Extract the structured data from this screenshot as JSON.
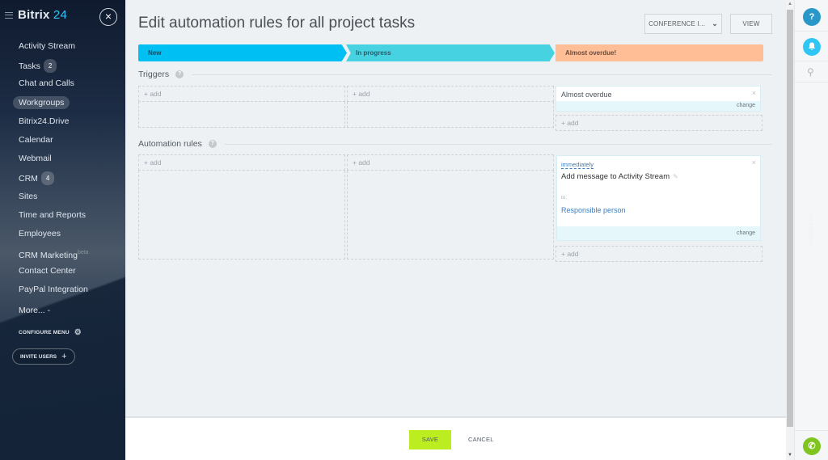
{
  "app": {
    "logo_name": "Bitrix",
    "logo_num": "24",
    "close_label": "×"
  },
  "sidebar": {
    "items": [
      {
        "label": "Activity Stream"
      },
      {
        "label": "Tasks",
        "badge": "2"
      },
      {
        "label": "Chat and Calls"
      },
      {
        "label": "Workgroups",
        "active": true
      },
      {
        "label": "Bitrix24.Drive"
      },
      {
        "label": "Calendar"
      },
      {
        "label": "Webmail"
      },
      {
        "label": "CRM",
        "badge": "4"
      },
      {
        "label": "Sites"
      },
      {
        "label": "Time and Reports"
      },
      {
        "label": "Employees"
      },
      {
        "label": "CRM Marketing",
        "suffix": "beta"
      },
      {
        "label": "Contact Center"
      },
      {
        "label": "PayPal Integration"
      },
      {
        "label": "More... -"
      }
    ],
    "configure_label": "CONFIGURE MENU",
    "invite_label": "INVITE USERS"
  },
  "header": {
    "title": "Edit automation rules for all project tasks",
    "conference_label": "CONFERENCE I...",
    "view_label": "VIEW"
  },
  "stages": [
    {
      "label": "New",
      "color": "#00bff2"
    },
    {
      "label": "In progress",
      "color": "#47d2e2"
    },
    {
      "label": "Almost overdue!",
      "color": "#ffbe95"
    }
  ],
  "triggers": {
    "heading": "Triggers",
    "help": "?",
    "add_label": "+ add",
    "card": {
      "name": "Almost overdue",
      "close": "×",
      "change_label": "change"
    }
  },
  "rules": {
    "heading": "Automation rules",
    "help": "?",
    "add_label": "+ add",
    "card": {
      "timing": "immediately",
      "title": "Add message to Activity Stream",
      "to_label": "to:",
      "recipient": "Responsible person",
      "close": "×",
      "change_label": "change"
    }
  },
  "footer": {
    "save_label": "SAVE",
    "cancel_label": "CANCEL",
    "save_color": "#bbed21"
  },
  "right_panel": {
    "help_label": "?",
    "contacts_text": "No contacts"
  }
}
